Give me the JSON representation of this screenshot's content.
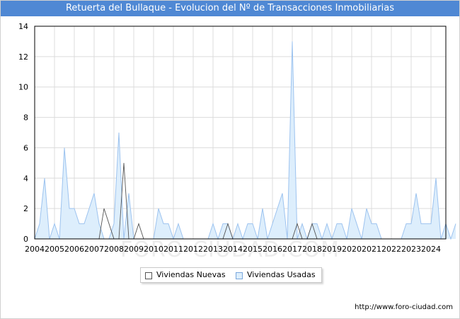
{
  "chart_data": {
    "type": "area",
    "title": "Retuerta del Bullaque - Evolucion del Nº de Transacciones Inmobiliarias",
    "xlabel": "",
    "ylabel": "",
    "ylim": [
      0,
      14
    ],
    "yticks": [
      "0",
      "2",
      "4",
      "6",
      "8",
      "10",
      "12",
      "14"
    ],
    "xticks": [
      "2004",
      "2005",
      "2006",
      "2007",
      "2008",
      "2009",
      "2010",
      "2011",
      "2012",
      "2013",
      "2014",
      "2015",
      "2016",
      "2017",
      "2018",
      "2019",
      "2020",
      "2021",
      "2022",
      "2023",
      "2024"
    ],
    "x_start_year": 2004,
    "x_end_year": 2024.75,
    "quarter_step": 0.25,
    "grid": true,
    "legend_position": "bottom",
    "series": [
      {
        "name": "Viviendas Nuevas",
        "color": "#555555",
        "fill": "#ffffff",
        "values": [
          0,
          0,
          0,
          0,
          0,
          0,
          0,
          0,
          0,
          0,
          0,
          0,
          0,
          0,
          2,
          1,
          0,
          0,
          5,
          0,
          0,
          1,
          0,
          0,
          0,
          0,
          0,
          0,
          0,
          0,
          0,
          0,
          0,
          0,
          0,
          0,
          0,
          0,
          0,
          1,
          0,
          0,
          0,
          0,
          0,
          0,
          0,
          0,
          0,
          0,
          0,
          0,
          0,
          1,
          0,
          0,
          1,
          0,
          0,
          0,
          0,
          0,
          0,
          0,
          0,
          0,
          0,
          0,
          0,
          0,
          0,
          0,
          0,
          0,
          0,
          0,
          0,
          0,
          0,
          0,
          0,
          0,
          0,
          0
        ]
      },
      {
        "name": "Viviendas Usadas",
        "color": "#9dc3ef",
        "fill": "#ddeefc",
        "values": [
          0,
          1,
          4,
          0,
          1,
          0,
          6,
          2,
          2,
          1,
          1,
          2,
          3,
          1,
          0,
          0,
          1,
          7,
          0,
          3,
          0,
          0,
          0,
          0,
          0,
          2,
          1,
          1,
          0,
          1,
          0,
          0,
          0,
          0,
          0,
          0,
          1,
          0,
          1,
          1,
          0,
          1,
          0,
          1,
          1,
          0,
          2,
          0,
          1,
          2,
          3,
          0,
          13,
          0,
          1,
          0,
          1,
          1,
          0,
          1,
          0,
          1,
          1,
          0,
          2,
          1,
          0,
          2,
          1,
          1,
          0,
          0,
          0,
          0,
          0,
          1,
          1,
          3,
          1,
          1,
          1,
          4,
          0,
          1,
          0,
          1
        ]
      }
    ]
  },
  "legend": {
    "nuevas_label": "Viviendas Nuevas",
    "usadas_label": "Viviendas Usadas"
  },
  "footer": {
    "url": "http://www.foro-ciudad.com",
    "watermark": "FORO-CIUDAD.COM"
  }
}
